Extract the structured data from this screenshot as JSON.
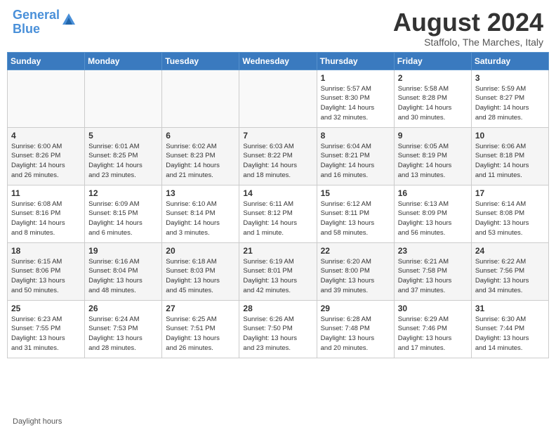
{
  "header": {
    "logo_line1": "General",
    "logo_line2": "Blue",
    "month_year": "August 2024",
    "location": "Staffolo, The Marches, Italy"
  },
  "footer": {
    "daylight_label": "Daylight hours"
  },
  "days_of_week": [
    "Sunday",
    "Monday",
    "Tuesday",
    "Wednesday",
    "Thursday",
    "Friday",
    "Saturday"
  ],
  "weeks": [
    [
      {
        "day": "",
        "info": ""
      },
      {
        "day": "",
        "info": ""
      },
      {
        "day": "",
        "info": ""
      },
      {
        "day": "",
        "info": ""
      },
      {
        "day": "1",
        "info": "Sunrise: 5:57 AM\nSunset: 8:30 PM\nDaylight: 14 hours\nand 32 minutes."
      },
      {
        "day": "2",
        "info": "Sunrise: 5:58 AM\nSunset: 8:28 PM\nDaylight: 14 hours\nand 30 minutes."
      },
      {
        "day": "3",
        "info": "Sunrise: 5:59 AM\nSunset: 8:27 PM\nDaylight: 14 hours\nand 28 minutes."
      }
    ],
    [
      {
        "day": "4",
        "info": "Sunrise: 6:00 AM\nSunset: 8:26 PM\nDaylight: 14 hours\nand 26 minutes."
      },
      {
        "day": "5",
        "info": "Sunrise: 6:01 AM\nSunset: 8:25 PM\nDaylight: 14 hours\nand 23 minutes."
      },
      {
        "day": "6",
        "info": "Sunrise: 6:02 AM\nSunset: 8:23 PM\nDaylight: 14 hours\nand 21 minutes."
      },
      {
        "day": "7",
        "info": "Sunrise: 6:03 AM\nSunset: 8:22 PM\nDaylight: 14 hours\nand 18 minutes."
      },
      {
        "day": "8",
        "info": "Sunrise: 6:04 AM\nSunset: 8:21 PM\nDaylight: 14 hours\nand 16 minutes."
      },
      {
        "day": "9",
        "info": "Sunrise: 6:05 AM\nSunset: 8:19 PM\nDaylight: 14 hours\nand 13 minutes."
      },
      {
        "day": "10",
        "info": "Sunrise: 6:06 AM\nSunset: 8:18 PM\nDaylight: 14 hours\nand 11 minutes."
      }
    ],
    [
      {
        "day": "11",
        "info": "Sunrise: 6:08 AM\nSunset: 8:16 PM\nDaylight: 14 hours\nand 8 minutes."
      },
      {
        "day": "12",
        "info": "Sunrise: 6:09 AM\nSunset: 8:15 PM\nDaylight: 14 hours\nand 6 minutes."
      },
      {
        "day": "13",
        "info": "Sunrise: 6:10 AM\nSunset: 8:14 PM\nDaylight: 14 hours\nand 3 minutes."
      },
      {
        "day": "14",
        "info": "Sunrise: 6:11 AM\nSunset: 8:12 PM\nDaylight: 14 hours\nand 1 minute."
      },
      {
        "day": "15",
        "info": "Sunrise: 6:12 AM\nSunset: 8:11 PM\nDaylight: 13 hours\nand 58 minutes."
      },
      {
        "day": "16",
        "info": "Sunrise: 6:13 AM\nSunset: 8:09 PM\nDaylight: 13 hours\nand 56 minutes."
      },
      {
        "day": "17",
        "info": "Sunrise: 6:14 AM\nSunset: 8:08 PM\nDaylight: 13 hours\nand 53 minutes."
      }
    ],
    [
      {
        "day": "18",
        "info": "Sunrise: 6:15 AM\nSunset: 8:06 PM\nDaylight: 13 hours\nand 50 minutes."
      },
      {
        "day": "19",
        "info": "Sunrise: 6:16 AM\nSunset: 8:04 PM\nDaylight: 13 hours\nand 48 minutes."
      },
      {
        "day": "20",
        "info": "Sunrise: 6:18 AM\nSunset: 8:03 PM\nDaylight: 13 hours\nand 45 minutes."
      },
      {
        "day": "21",
        "info": "Sunrise: 6:19 AM\nSunset: 8:01 PM\nDaylight: 13 hours\nand 42 minutes."
      },
      {
        "day": "22",
        "info": "Sunrise: 6:20 AM\nSunset: 8:00 PM\nDaylight: 13 hours\nand 39 minutes."
      },
      {
        "day": "23",
        "info": "Sunrise: 6:21 AM\nSunset: 7:58 PM\nDaylight: 13 hours\nand 37 minutes."
      },
      {
        "day": "24",
        "info": "Sunrise: 6:22 AM\nSunset: 7:56 PM\nDaylight: 13 hours\nand 34 minutes."
      }
    ],
    [
      {
        "day": "25",
        "info": "Sunrise: 6:23 AM\nSunset: 7:55 PM\nDaylight: 13 hours\nand 31 minutes."
      },
      {
        "day": "26",
        "info": "Sunrise: 6:24 AM\nSunset: 7:53 PM\nDaylight: 13 hours\nand 28 minutes."
      },
      {
        "day": "27",
        "info": "Sunrise: 6:25 AM\nSunset: 7:51 PM\nDaylight: 13 hours\nand 26 minutes."
      },
      {
        "day": "28",
        "info": "Sunrise: 6:26 AM\nSunset: 7:50 PM\nDaylight: 13 hours\nand 23 minutes."
      },
      {
        "day": "29",
        "info": "Sunrise: 6:28 AM\nSunset: 7:48 PM\nDaylight: 13 hours\nand 20 minutes."
      },
      {
        "day": "30",
        "info": "Sunrise: 6:29 AM\nSunset: 7:46 PM\nDaylight: 13 hours\nand 17 minutes."
      },
      {
        "day": "31",
        "info": "Sunrise: 6:30 AM\nSunset: 7:44 PM\nDaylight: 13 hours\nand 14 minutes."
      }
    ]
  ]
}
